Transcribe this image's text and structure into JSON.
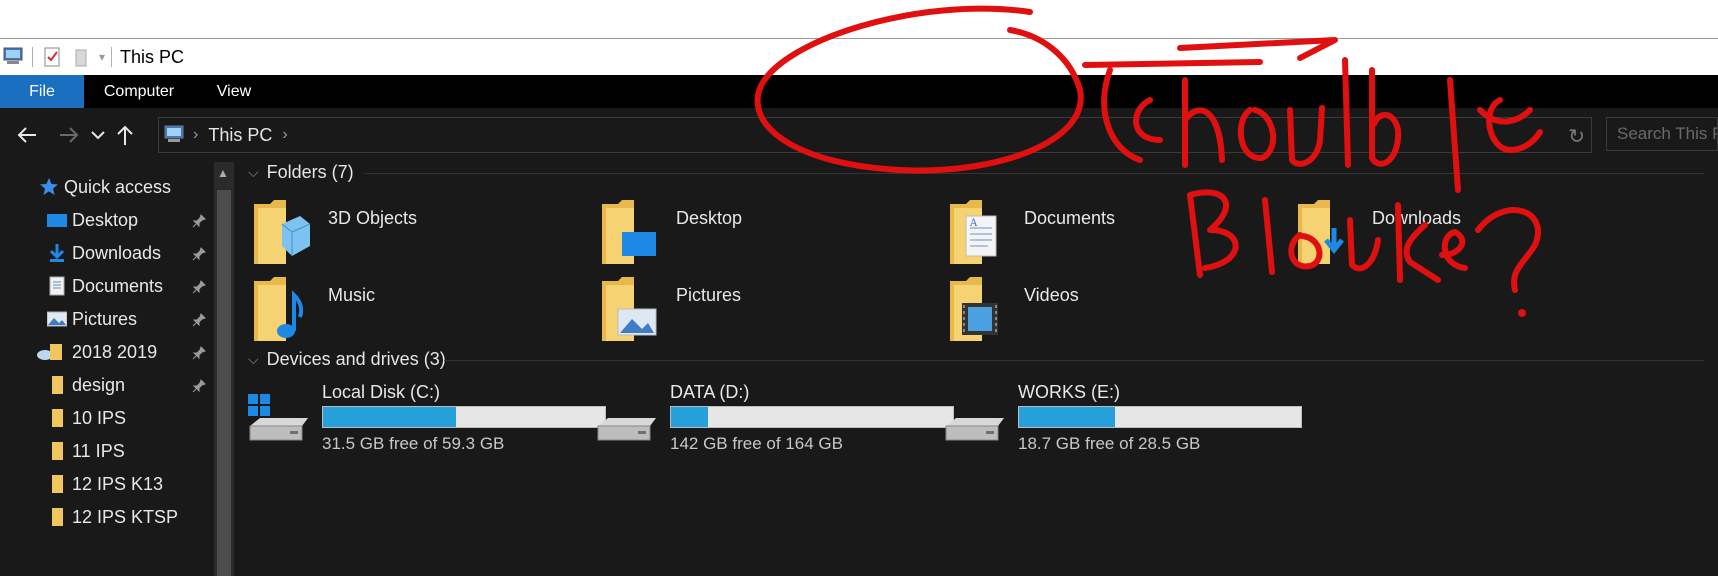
{
  "window": {
    "title": "This PC"
  },
  "ribbon": {
    "tabs": [
      "File",
      "Computer",
      "View"
    ]
  },
  "address": {
    "path": "This PC",
    "search_placeholder": "Search This PC"
  },
  "sidebar": {
    "items": [
      {
        "label": "Quick access",
        "icon": "star-icon"
      },
      {
        "label": "Desktop",
        "icon": "desktop-icon",
        "pinned": true
      },
      {
        "label": "Downloads",
        "icon": "download-arrow-icon",
        "pinned": true
      },
      {
        "label": "Documents",
        "icon": "document-icon",
        "pinned": true
      },
      {
        "label": "Pictures",
        "icon": "picture-icon",
        "pinned": true
      },
      {
        "label": "2018 2019",
        "icon": "onedrive-folder-icon",
        "pinned": true
      },
      {
        "label": "design",
        "icon": "folder-icon",
        "pinned": true
      },
      {
        "label": "10 IPS",
        "icon": "folder-icon"
      },
      {
        "label": "11 IPS",
        "icon": "folder-icon"
      },
      {
        "label": "12 IPS K13",
        "icon": "folder-icon"
      },
      {
        "label": "12 IPS KTSP",
        "icon": "folder-icon"
      }
    ]
  },
  "folders": {
    "header": "Folders (7)",
    "items": [
      {
        "label": "3D Objects",
        "icon": "3d-objects-folder-icon"
      },
      {
        "label": "Desktop",
        "icon": "desktop-folder-icon"
      },
      {
        "label": "Documents",
        "icon": "documents-folder-icon"
      },
      {
        "label": "Downloads",
        "icon": "downloads-folder-icon"
      },
      {
        "label": "Music",
        "icon": "music-folder-icon"
      },
      {
        "label": "Pictures",
        "icon": "pictures-folder-icon"
      },
      {
        "label": "Videos",
        "icon": "videos-folder-icon"
      }
    ]
  },
  "devices": {
    "header": "Devices and drives (3)",
    "items": [
      {
        "label": "Local Disk (C:)",
        "free": "31.5 GB free of 59.3 GB",
        "used_fraction": 0.47,
        "icon": "windows-drive-icon"
      },
      {
        "label": "DATA (D:)",
        "free": "142 GB free of 164 GB",
        "used_fraction": 0.13,
        "icon": "hard-drive-icon"
      },
      {
        "label": "WORKS (E:)",
        "free": "18.7 GB free of 28.5 GB",
        "used_fraction": 0.34,
        "icon": "hard-drive-icon"
      }
    ]
  },
  "annotation": {
    "text": "should be Black?",
    "color": "#e01010"
  },
  "colors": {
    "accent": "#1a6fc0",
    "drive_fill": "#26a0da",
    "background": "#191919"
  }
}
